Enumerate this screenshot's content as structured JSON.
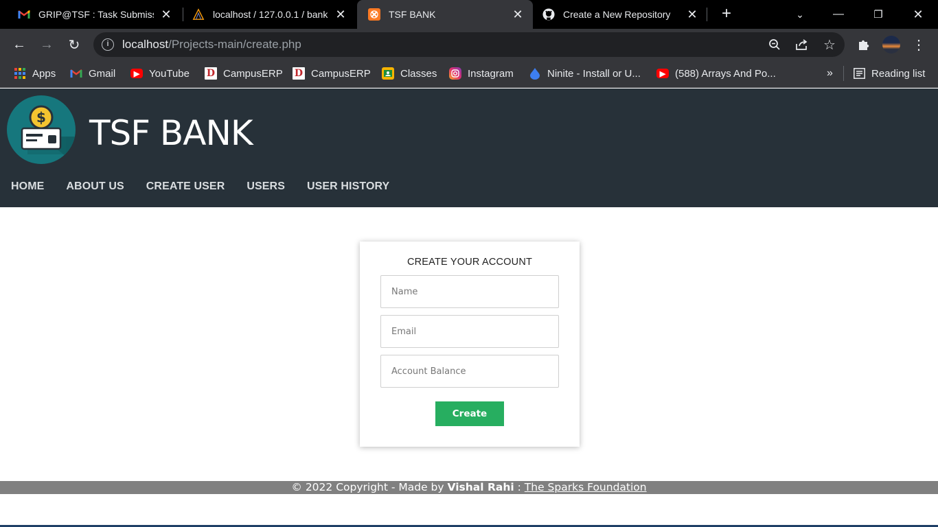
{
  "browser": {
    "tabs": [
      {
        "title": "GRIP@TSF : Task Submissio",
        "icon": "gmail-icon"
      },
      {
        "title": "localhost / 127.0.0.1 / bank",
        "icon": "phpmyadmin-icon"
      },
      {
        "title": "TSF BANK",
        "icon": "xampp-icon"
      },
      {
        "title": "Create a New Repository",
        "icon": "github-icon"
      }
    ],
    "url_host": "localhost",
    "url_path": "/Projects-main/create.php",
    "bookmarks": [
      {
        "label": "Apps",
        "icon": "apps-grid-icon"
      },
      {
        "label": "Gmail",
        "icon": "gmail-icon"
      },
      {
        "label": "YouTube",
        "icon": "youtube-icon"
      },
      {
        "label": "CampusERP",
        "icon": "campuserp-icon"
      },
      {
        "label": "CampusERP",
        "icon": "campuserp-icon"
      },
      {
        "label": "Classes",
        "icon": "classroom-icon"
      },
      {
        "label": "Instagram",
        "icon": "instagram-icon"
      },
      {
        "label": "Ninite - Install or U...",
        "icon": "ninite-icon"
      },
      {
        "label": "(588) Arrays And Po...",
        "icon": "youtube-icon"
      }
    ],
    "overflow": "»",
    "reading_list": "Reading list"
  },
  "site": {
    "brand": "TSF BANK",
    "menu": [
      "HOME",
      "ABOUT US",
      "CREATE USER",
      "USERS",
      "USER HISTORY"
    ]
  },
  "form": {
    "heading": "CREATE YOUR ACCOUNT",
    "name_placeholder": "Name",
    "email_placeholder": "Email",
    "balance_placeholder": "Account Balance",
    "submit_label": "Create"
  },
  "footer": {
    "text": "© 2022 Copyright - Made by ",
    "author": "Vishal Rahi",
    "separator": " : ",
    "link": "The Sparks Foundation"
  },
  "colors": {
    "header_bg": "#273139",
    "button": "#27ae60",
    "footer_bg": "#808080"
  }
}
